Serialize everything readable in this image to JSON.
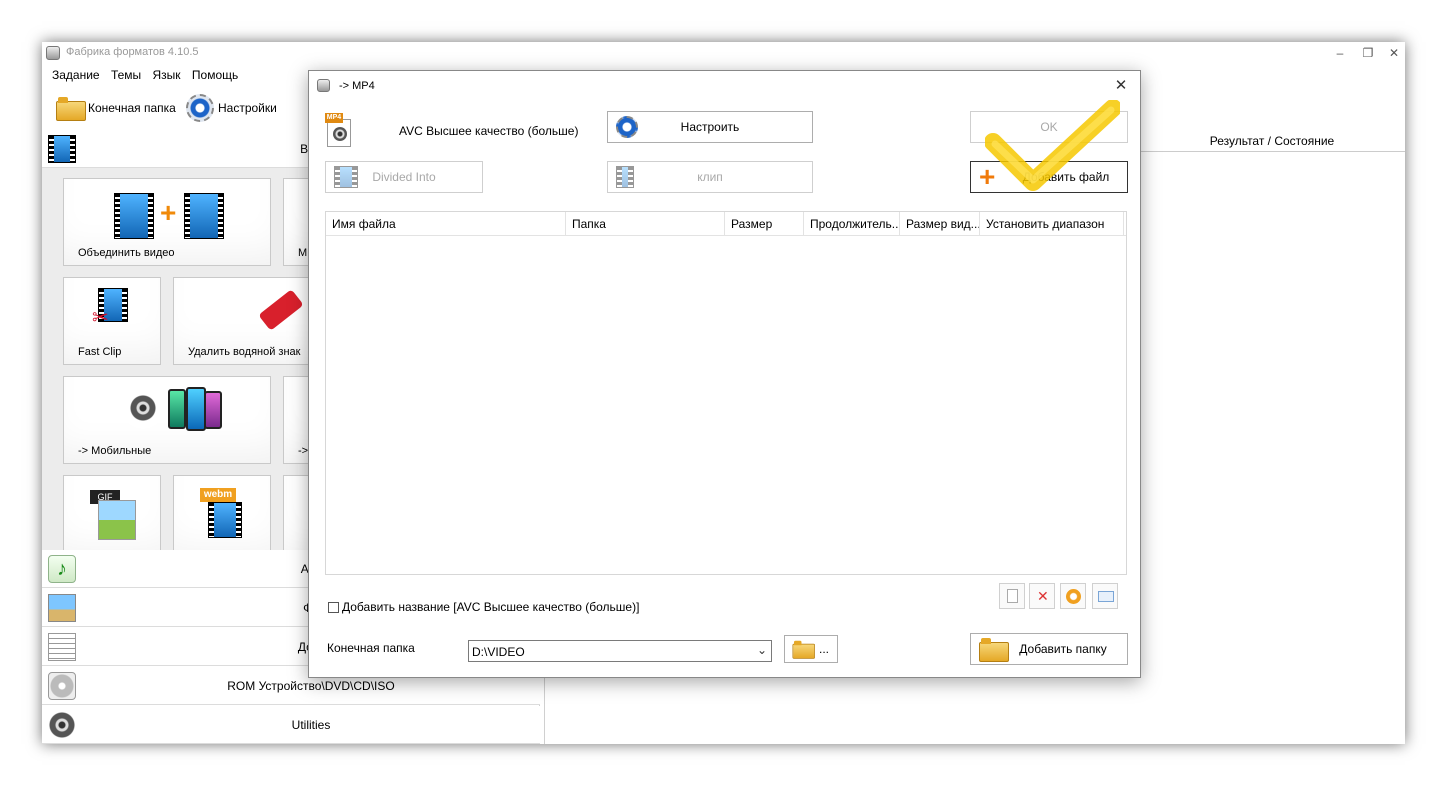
{
  "main_window": {
    "title": "Фабрика форматов 4.10.5",
    "menu": [
      "Задание",
      "Темы",
      "Язык",
      "Помощь"
    ],
    "toolbar": {
      "output_folder": "Конечная папка",
      "settings": "Настройки"
    },
    "controls": {
      "minimize": "–",
      "restore": "❐",
      "close": "✕"
    }
  },
  "left_panel": {
    "video_category": "Вид",
    "tiles": [
      {
        "label": "Объединить видео"
      },
      {
        "label": "М"
      },
      {
        "label": "Fast Clip"
      },
      {
        "label": "Удалить водяной знак"
      },
      {
        "label": "-> Мобильные"
      },
      {
        "label": "->"
      },
      {
        "label": "GIF"
      },
      {
        "label": "webm"
      }
    ],
    "categories": [
      {
        "label": "Ауд",
        "icon": "music-note-icon"
      },
      {
        "label": "Фо",
        "icon": "photo-icon"
      },
      {
        "label": "Доку",
        "icon": "document-icon"
      },
      {
        "label": "ROM Устройство\\DVD\\CD\\ISO",
        "icon": "disc-icon"
      },
      {
        "label": "Utilities",
        "icon": "film-reel-icon"
      }
    ]
  },
  "result_panel": {
    "header": "Результат / Состояние"
  },
  "dialog": {
    "title": "-> MP4",
    "profile_badge": "MP4",
    "profile": "AVC Высшее качество (больше)",
    "buttons": {
      "configure": "Настроить",
      "ok": "OK",
      "divided_into": "Divided Into",
      "clip": "клип",
      "add_file": "Добавить файл",
      "add_folder": "Добавить папку",
      "browse": "..."
    },
    "columns": [
      "Имя файла",
      "Папка",
      "Размер",
      "Продолжитель...",
      "Размер вид...",
      "Установить диапазон"
    ],
    "add_title_checkbox": "Добавить название [AVC Высшее качество (больше)]",
    "destination_label": "Конечная папка",
    "destination_value": "D:\\VIDEO",
    "close": "✕"
  }
}
